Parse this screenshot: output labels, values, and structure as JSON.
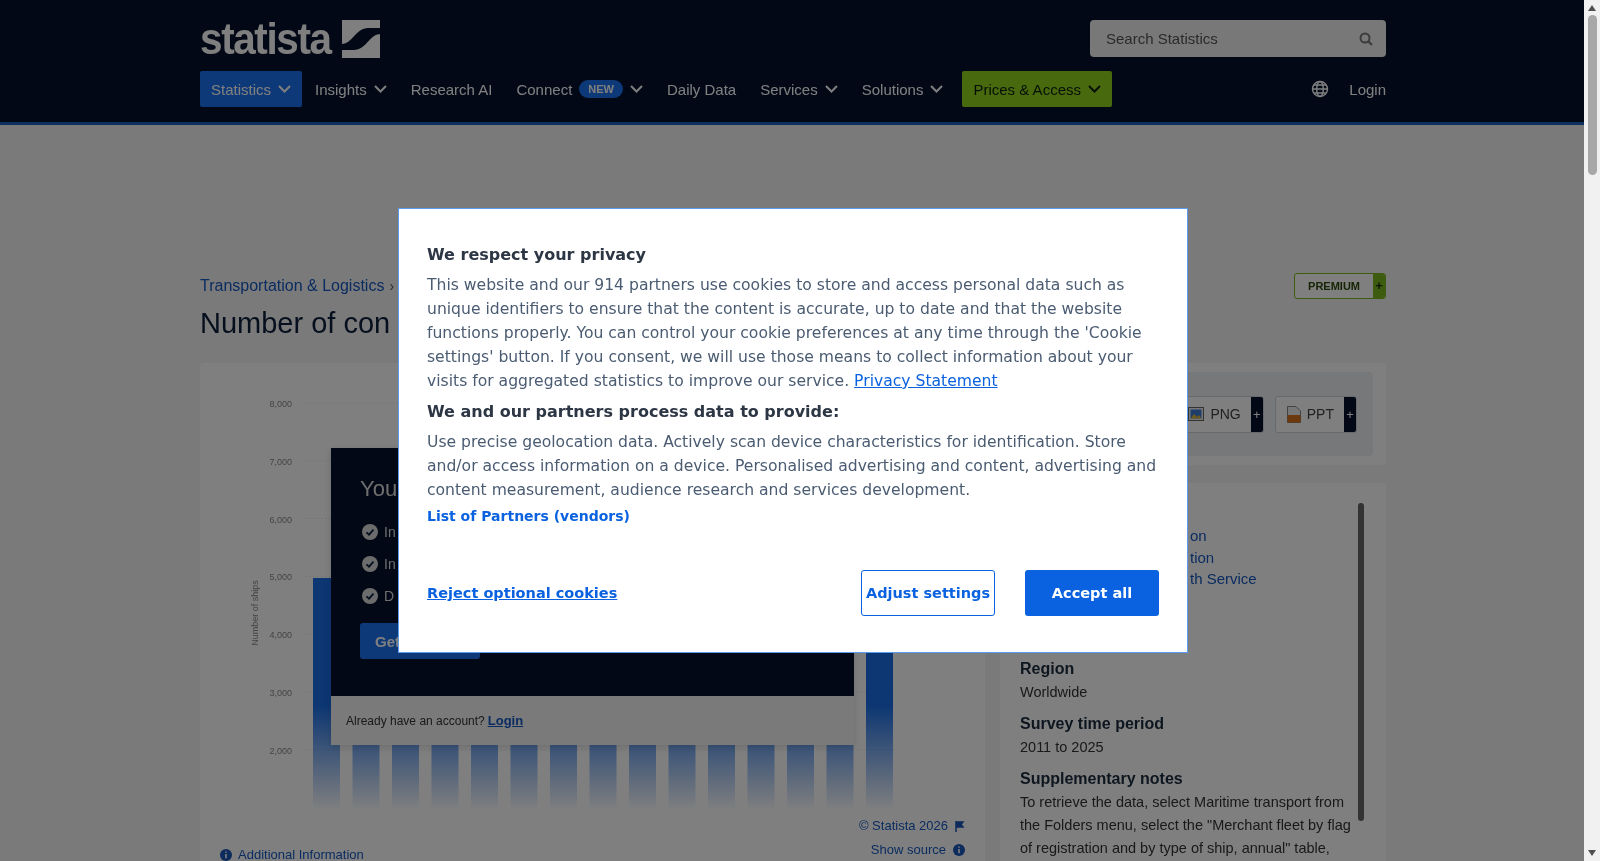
{
  "header": {
    "logo": "statista",
    "search": {
      "placeholder": "Search Statistics"
    },
    "nav": [
      {
        "label": "Statistics",
        "kind": "menu",
        "dropdown": true,
        "selected": true
      },
      {
        "label": "Insights",
        "kind": "menu",
        "dropdown": true,
        "selected": false
      },
      {
        "label": "Research AI",
        "kind": "menu",
        "dropdown": false,
        "selected": false
      },
      {
        "label": "Connect",
        "kind": "menu",
        "badge": "NEW",
        "dropdown": true,
        "selected": false
      },
      {
        "label": "Daily Data",
        "kind": "menu",
        "dropdown": false,
        "selected": false
      },
      {
        "label": "Services",
        "kind": "menu",
        "dropdown": true,
        "selected": false
      },
      {
        "label": "Solutions",
        "kind": "menu",
        "dropdown": true,
        "selected": false
      },
      {
        "label": "Prices & Access",
        "kind": "cta",
        "dropdown": true,
        "selected": false
      }
    ],
    "login": "Login"
  },
  "breadcrumb": {
    "link": "Transportation & Logistics",
    "separator": "›"
  },
  "premium_badge": {
    "label": "PREMIUM",
    "plus": "+"
  },
  "title": "Number of con",
  "chart": {
    "y_ticks": [
      "8,000",
      "7,000",
      "6,000",
      "5,000",
      "4,000",
      "3,000",
      "2,000"
    ],
    "ylabel": "Number of ships"
  },
  "paywall": {
    "heading": "You",
    "features": [
      "In",
      "In",
      "D"
    ],
    "button": "Get",
    "account_prompt": "Already have an account?",
    "login": "Login"
  },
  "chart_footer": {
    "additional_info": "Additional Information",
    "copyright": "© Statista 2026",
    "show_source": "Show source"
  },
  "downloads": [
    {
      "label": "PNG",
      "kind": "image",
      "plus": "+"
    },
    {
      "label": "PPT",
      "kind": "slides",
      "plus": "+"
    }
  ],
  "details": {
    "links": [
      "on",
      "tion",
      "th Service"
    ],
    "fields": [
      {
        "heading": "Region",
        "value": "Worldwide"
      },
      {
        "heading": "Survey time period",
        "value": "2011 to 2025"
      },
      {
        "heading": "Supplementary notes",
        "value": "To retrieve the data, select Maritime transport from the Folders menu, select the \"Merchant fleet by flag of registration and by type of ship, annual\" table,"
      }
    ]
  },
  "cookie_dialog": {
    "title": "We respect your privacy",
    "text": "This website and our 914 partners use cookies to store and access personal data such as unique identifiers to ensure that the content is accurate, up to date and that the website functions properly. You can control your cookie preferences at any time through the 'Cookie settings' button. If you consent, we will use those means to collect information about your visits for aggregated statistics to improve our service.",
    "privacy_link": "Privacy Statement",
    "purposes_heading": "We and our partners process data to provide:",
    "purposes": "Use precise geolocation data. Actively scan device characteristics for identification. Store and/or access information on a device. Personalised advertising and content, advertising and content measurement, audience research and services development.",
    "partners_link": "List of Partners (vendors)",
    "buttons": [
      {
        "label": "Reject optional cookies",
        "kind": "link"
      },
      {
        "label": "Adjust settings",
        "kind": "outline"
      },
      {
        "label": "Accept all",
        "kind": "primary"
      }
    ]
  }
}
